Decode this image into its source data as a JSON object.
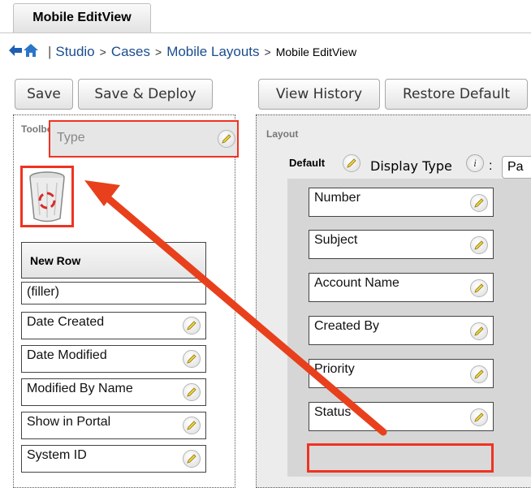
{
  "tab": {
    "label": "Mobile EditView"
  },
  "breadcrumb": {
    "separator": "|",
    "items": [
      "Studio",
      "Cases",
      "Mobile Layouts"
    ],
    "current": "Mobile EditView",
    "gt": ">"
  },
  "toolbox": {
    "buttons": {
      "save": "Save",
      "save_deploy": "Save & Deploy"
    },
    "label": "Toolbox",
    "dragging_field": "Type",
    "new_row": "New Row",
    "filler": "(filler)",
    "fields": [
      "Date Created",
      "Date Modified",
      "Modified By Name",
      "Show in Portal",
      "System ID"
    ]
  },
  "layout": {
    "buttons": {
      "view_history": "View History",
      "restore_default": "Restore Default"
    },
    "label": "Layout",
    "panel_name": "Default",
    "display_type_label": "Display Type",
    "display_type_colon": ":",
    "display_type_value": "Pa",
    "fields": [
      "Number",
      "Subject",
      "Account Name",
      "Created By",
      "Priority",
      "Status"
    ]
  },
  "colors": {
    "highlight": "#ee3322",
    "link": "#1a4d8f",
    "arrow": "#e8401c"
  }
}
